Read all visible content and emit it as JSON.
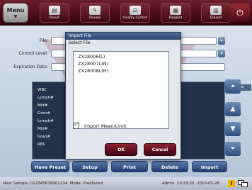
{
  "toolbar": {
    "menu_label": "Menu",
    "buttons": [
      {
        "label": "Result",
        "icon": "result-icon"
      },
      {
        "label": "Review",
        "icon": "review-icon"
      },
      {
        "label": "Quality Control",
        "icon": "balance-scale-icon"
      },
      {
        "label": "Reagent",
        "icon": "reagent-icon"
      },
      {
        "label": "Diluent",
        "icon": "diluent-icon"
      }
    ],
    "power_icon": "power-icon"
  },
  "form": {
    "file_label": "File:",
    "control_level_label": "Control Level:",
    "expiration_date_label": "Expiration Date:"
  },
  "table": {
    "rows": [
      "WBC",
      "Lymph#",
      "Mid#",
      "Gran#",
      "Lymph#",
      "Mid#",
      "Gran#",
      "RBC"
    ],
    "right_header": "ess"
  },
  "bottom_buttons": {
    "have_preset": "Have Preset",
    "setup": "Setup",
    "print": "Print",
    "delete": "Delete",
    "import": "Import"
  },
  "status": {
    "next_sample": "Next Sample: 012345678901234",
    "mode": "Mode: Prediluted",
    "user": "Admin",
    "time": "10:33:20",
    "date": "2010-05-26"
  },
  "dialog": {
    "title": "Import File",
    "subtitle": "Select File",
    "files": [
      "ZX28006(L)",
      "ZX28007L(N)",
      "ZX28008L(H)"
    ],
    "import_mean_limit_label": "Import Mean/Limit",
    "import_mean_limit_checked": true,
    "ok_label": "OK",
    "cancel_label": "Cancel"
  },
  "colors": {
    "toolbar": "#4a0e18",
    "accent_button": "#1d3a6b",
    "dialog_button": "#8c2233",
    "warning": "#f0b400"
  }
}
